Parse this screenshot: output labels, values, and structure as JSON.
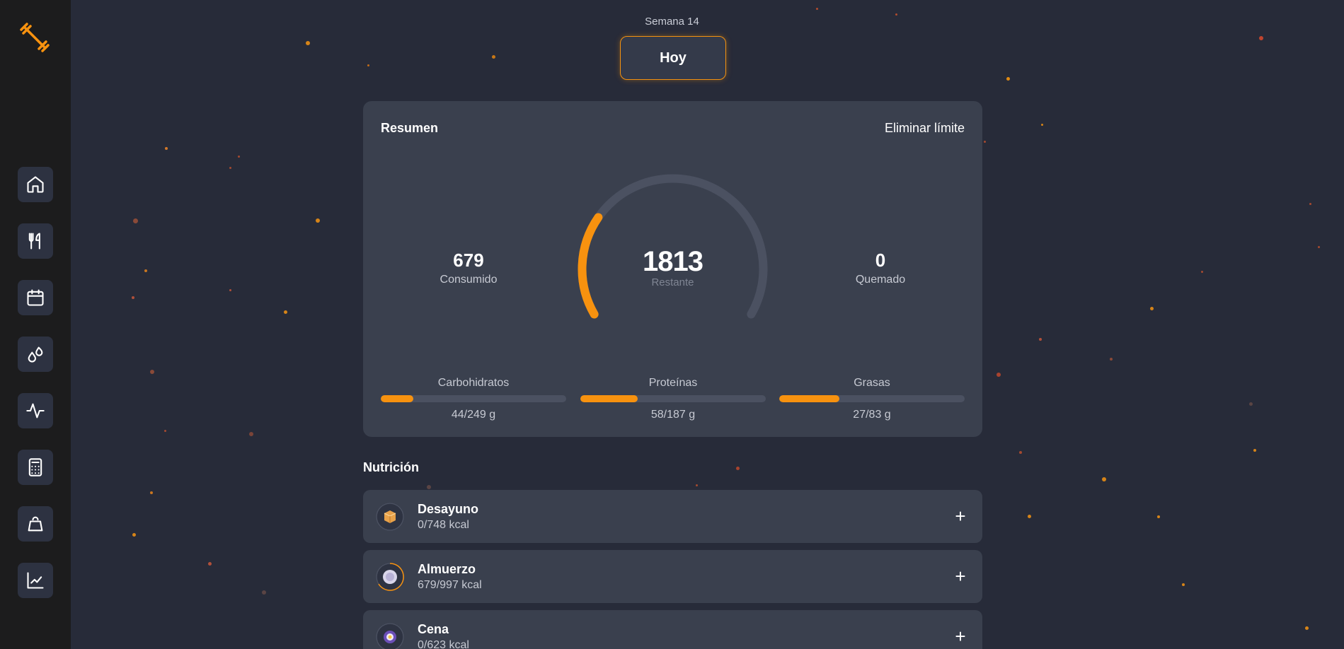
{
  "sidebar": {
    "logo_icon": "dumbbell-icon",
    "items": [
      {
        "name": "home",
        "icon": "home-icon"
      },
      {
        "name": "meals",
        "icon": "fork-knife-icon"
      },
      {
        "name": "calendar",
        "icon": "calendar-icon"
      },
      {
        "name": "water",
        "icon": "droplets-icon"
      },
      {
        "name": "activity",
        "icon": "activity-icon"
      },
      {
        "name": "calculator",
        "icon": "calculator-icon"
      },
      {
        "name": "weight",
        "icon": "weight-icon"
      },
      {
        "name": "stats",
        "icon": "line-chart-icon"
      }
    ]
  },
  "header": {
    "week_label": "Semana 14",
    "today_button": "Hoy"
  },
  "summary": {
    "title": "Resumen",
    "remove_limit": "Eliminar límite",
    "consumed": {
      "value": "679",
      "label": "Consumido"
    },
    "remaining": {
      "value": "1813",
      "label": "Restante"
    },
    "burned": {
      "value": "0",
      "label": "Quemado"
    },
    "gauge_progress": 0.27,
    "macros": [
      {
        "name": "Carbohidratos",
        "amount": "44/249 g",
        "fraction": 0.177
      },
      {
        "name": "Proteínas",
        "amount": "58/187 g",
        "fraction": 0.31
      },
      {
        "name": "Grasas",
        "amount": "27/83 g",
        "fraction": 0.325
      }
    ]
  },
  "nutrition": {
    "title": "Nutrición",
    "meals": [
      {
        "name": "Desayuno",
        "kcal": "0/748 kcal",
        "icon": "breakfast-box-icon",
        "add_label": "+"
      },
      {
        "name": "Almuerzo",
        "kcal": "679/997 kcal",
        "icon": "lunch-plate-icon",
        "add_label": "+"
      },
      {
        "name": "Cena",
        "kcal": "0/623 kcal",
        "icon": "dinner-egg-icon",
        "add_label": "+"
      }
    ]
  },
  "colors": {
    "accent": "#f7920f",
    "background": "#272b39",
    "card": "#3a404e",
    "sidebar": "#1c1c1d"
  }
}
